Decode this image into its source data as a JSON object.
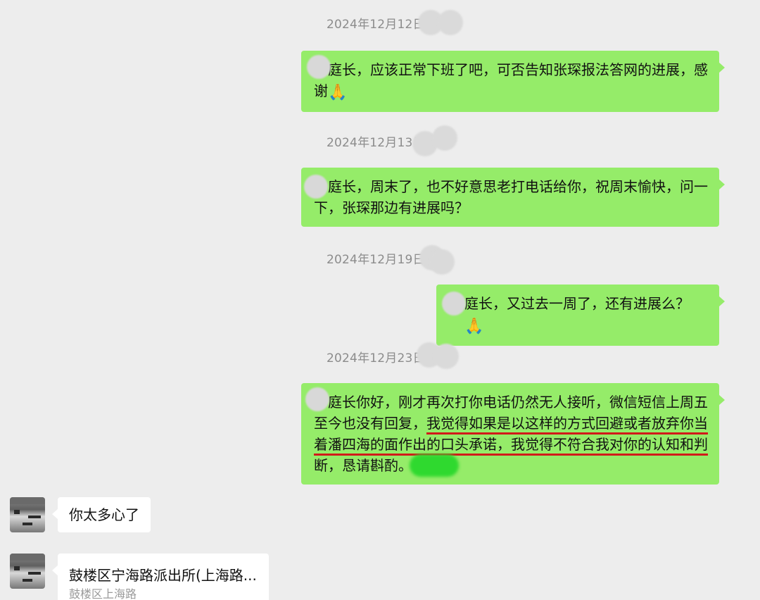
{
  "messages": [
    {
      "timestamp": "2024年12月12日",
      "text": "庭长，应该正常下班了吧，可否告知张琛报法答网的进展，感",
      "text_line2": "谢",
      "emoji": "clap-hands"
    },
    {
      "timestamp": "2024年12月13日",
      "text": "庭长，周末了，也不好意思老打电话给你，祝周末愉快，问一",
      "text_line2": "下，张琛那边有进展吗？"
    },
    {
      "timestamp": "2024年12月19日",
      "text": "庭长，又过去一周了，还有进展么？",
      "emoji": "clap-hands"
    },
    {
      "timestamp": "2024年12月23日",
      "line1": "庭长你好，刚才再次打你电话仍然无人接听，微信短信上周五",
      "line2_plain": "至今也没有回复，",
      "line2_underlined": "我觉得如果是以这样的方式回避或者放弃你当",
      "line3_underlined": "着潘四海的面作出的口头承诺，我觉得不符合我对你的认知和判",
      "line4": "断，恳请斟酌。"
    }
  ],
  "replies": [
    {
      "text": "你太多心了"
    },
    {
      "title": "鼓楼区宁海路派出所(上海路...",
      "subtitle": "鼓楼区上海路"
    }
  ],
  "colors": {
    "background": "#ededed",
    "outgoing_bubble": "#95ec69",
    "incoming_bubble": "#ffffff",
    "underline": "#d11a1a"
  },
  "icons": [
    "clap-hands-emoji",
    "avatar"
  ]
}
